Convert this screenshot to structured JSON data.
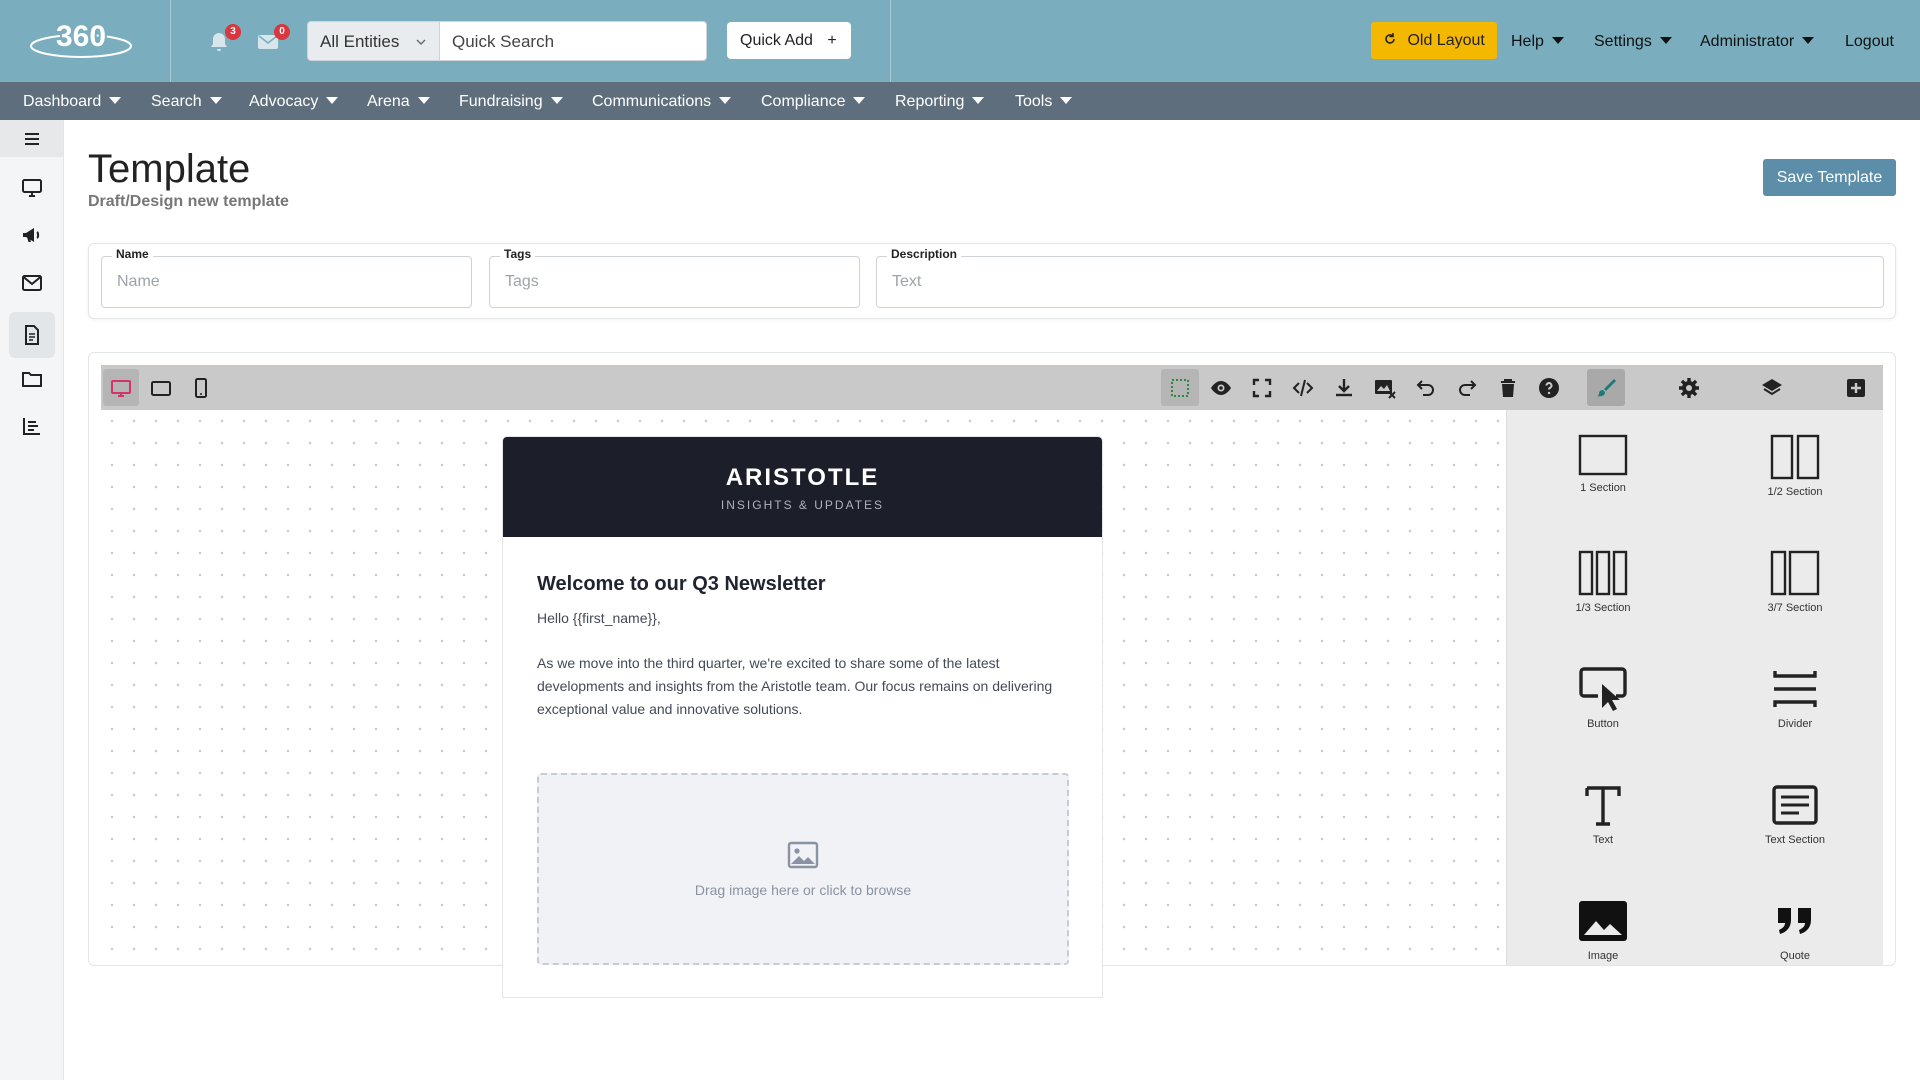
{
  "header": {
    "logo_text": "360",
    "notifications_count": "3",
    "messages_count": "0",
    "entity_select": "All Entities",
    "search_placeholder": "Quick Search",
    "quick_add": "Quick Add",
    "old_layout": "Old Layout",
    "help": "Help",
    "settings": "Settings",
    "user": "Administrator",
    "logout": "Logout"
  },
  "nav": [
    "Dashboard",
    "Search",
    "Advocacy",
    "Arena",
    "Fundraising",
    "Communications",
    "Compliance",
    "Reporting",
    "Tools"
  ],
  "page": {
    "title": "Template",
    "subtitle": "Draft/Design new template",
    "save_button": "Save Template"
  },
  "fields": {
    "name_label": "Name",
    "name_placeholder": "Name",
    "tags_label": "Tags",
    "tags_placeholder": "Tags",
    "description_label": "Description",
    "description_placeholder": "Text"
  },
  "newsletter": {
    "brand": "ARISTOTLE",
    "tagline": "INSIGHTS & UPDATES",
    "heading": "Welcome to our Q3 Newsletter",
    "greeting": "Hello {{first_name}},",
    "paragraph": "As we move into the third quarter, we're excited to share some of the latest developments and insights from the Aristotle team. Our focus remains on delivering exceptional value and innovative solutions.",
    "image_prompt": "Drag image here or click to browse"
  },
  "blocks": [
    "1 Section",
    "1/2 Section",
    "1/3 Section",
    "3/7 Section",
    "Button",
    "Divider",
    "Text",
    "Text Section",
    "Image",
    "Quote"
  ],
  "colors": {
    "header_bg": "#7aaebe",
    "nav_bg": "#5e6e7c",
    "accent_yellow": "#f5b800",
    "save_button": "#5d8ea9",
    "badge_red": "#d9363e",
    "desktop_view_active": "#d6336c",
    "newsletter_header": "#1c1f2a"
  }
}
